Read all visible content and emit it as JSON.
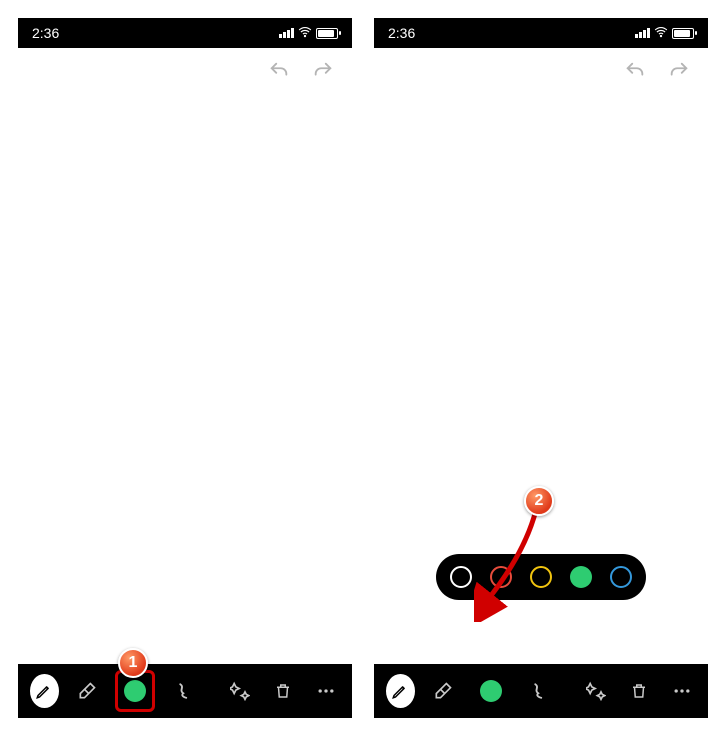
{
  "statusbar": {
    "time": "2:36"
  },
  "steps": {
    "one": "1",
    "two": "2"
  },
  "colors": {
    "active": "#2ecc71",
    "popup": [
      {
        "name": "black",
        "hex": "#000000",
        "ring": "#ffffff"
      },
      {
        "name": "red",
        "hex": "#e74c3c",
        "ring": "#e74c3c"
      },
      {
        "name": "yellow",
        "hex": "#f1c40f",
        "ring": "#f1c40f"
      },
      {
        "name": "green",
        "hex": "#2ecc71",
        "ring": "#2ecc71",
        "filled": true
      },
      {
        "name": "blue",
        "hex": "#3498db",
        "ring": "#3498db"
      }
    ]
  },
  "tooltips": {
    "pen": "Pen",
    "eraser": "Eraser",
    "color": "Color",
    "shape": "Line style",
    "effects": "Effects",
    "delete": "Delete",
    "more": "More"
  }
}
